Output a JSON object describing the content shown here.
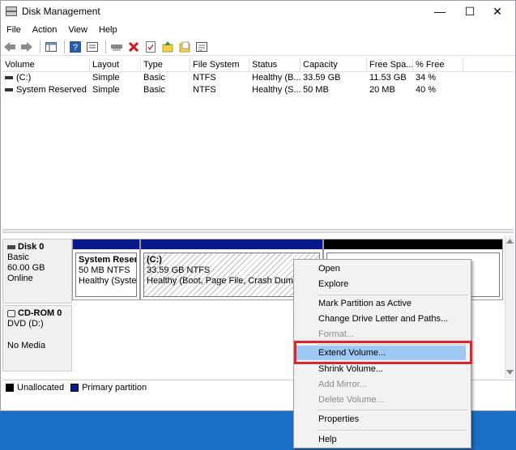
{
  "window": {
    "title": "Disk Management",
    "controls": {
      "minimize": "—",
      "maximize": "☐",
      "close": "✕"
    }
  },
  "menu": [
    "File",
    "Action",
    "View",
    "Help"
  ],
  "toolbar": {
    "icons": [
      "back-arrow-icon",
      "forward-arrow-icon",
      "console-tree-icon",
      "help-icon",
      "properties-icon",
      "connect-icon",
      "delete-icon",
      "check-icon",
      "folder-up-icon",
      "folder-open-icon",
      "list-view-icon"
    ]
  },
  "volume_list": {
    "columns": [
      "Volume",
      "Layout",
      "Type",
      "File System",
      "Status",
      "Capacity",
      "Free Spa...",
      "% Free"
    ],
    "rows": [
      [
        "(C:)",
        "Simple",
        "Basic",
        "NTFS",
        "Healthy (B...",
        "33.59 GB",
        "11.53 GB",
        "34 %"
      ],
      [
        "System Reserved",
        "Simple",
        "Basic",
        "NTFS",
        "Healthy (S...",
        "50 MB",
        "20 MB",
        "40 %"
      ]
    ]
  },
  "disks": {
    "disk0": {
      "name": "Disk 0",
      "type": "Basic",
      "size": "60.00 GB",
      "status": "Online",
      "partitions": [
        {
          "name": "System Reserv",
          "detail": "50 MB NTFS",
          "status": "Healthy (Systen"
        },
        {
          "name": "(C:)",
          "detail": "33.59 GB NTFS",
          "status": "Healthy (Boot, Page File, Crash Dump, Pr"
        }
      ]
    },
    "cdrom0": {
      "name": "CD-ROM 0",
      "type": "DVD (D:)",
      "status": "No Media"
    }
  },
  "legend": {
    "unallocated": "Unallocated",
    "primary": "Primary partition",
    "colors": {
      "unallocated": "#000000",
      "primary": "#0a1a8c"
    }
  },
  "context_menu": {
    "items": {
      "open": "Open",
      "explore": "Explore",
      "mark_active": "Mark Partition as Active",
      "change_letter": "Change Drive Letter and Paths...",
      "format": "Format...",
      "extend": "Extend Volume...",
      "shrink": "Shrink Volume...",
      "add_mirror": "Add Mirror...",
      "delete": "Delete Volume...",
      "properties": "Properties",
      "help": "Help"
    },
    "highlight_color": "#e0242c"
  }
}
